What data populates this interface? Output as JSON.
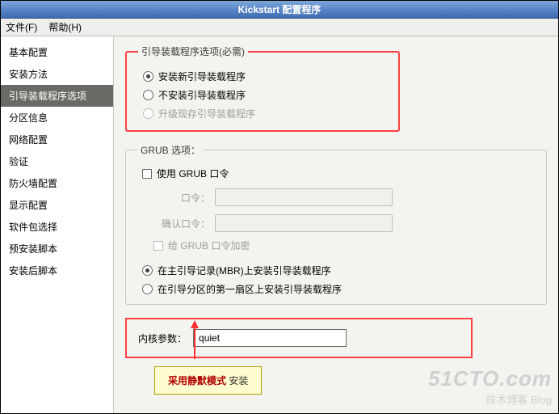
{
  "window": {
    "title": "Kickstart 配置程序"
  },
  "menu": {
    "file": "文件(F)",
    "help": "帮助(H)"
  },
  "sidebar": {
    "items": [
      "基本配置",
      "安装方法",
      "引导装载程序选项",
      "分区信息",
      "网络配置",
      "验证",
      "防火墙配置",
      "显示配置",
      "软件包选择",
      "预安装脚本",
      "安装后脚本"
    ],
    "selected_index": 2
  },
  "boot_options": {
    "legend": "引导装载程序选项(必需)",
    "radios": {
      "install_new": "安装新引导装载程序",
      "no_install": "不安装引导装载程序",
      "upgrade": "升级现存引导装载程序"
    },
    "selected": "install_new"
  },
  "grub": {
    "legend": "GRUB 选项：",
    "use_pass": "使用 GRUB 口令",
    "pass_label": "口令：",
    "confirm_label": "确认口令：",
    "encrypt": "给 GRUB 口令加密"
  },
  "install_loc": {
    "mbr": "在主引导记录(MBR)上安装引导装载程序",
    "first": "在引导分区的第一扇区上安装引导装载程序",
    "selected": "mbr"
  },
  "kernel": {
    "label": "内核参数：",
    "value": "quiet"
  },
  "annotation": {
    "prefix": "采用静默模式",
    "suffix": " 安装"
  },
  "watermark": {
    "big": "51CTO.com",
    "sub": "技术博客  Blog"
  }
}
